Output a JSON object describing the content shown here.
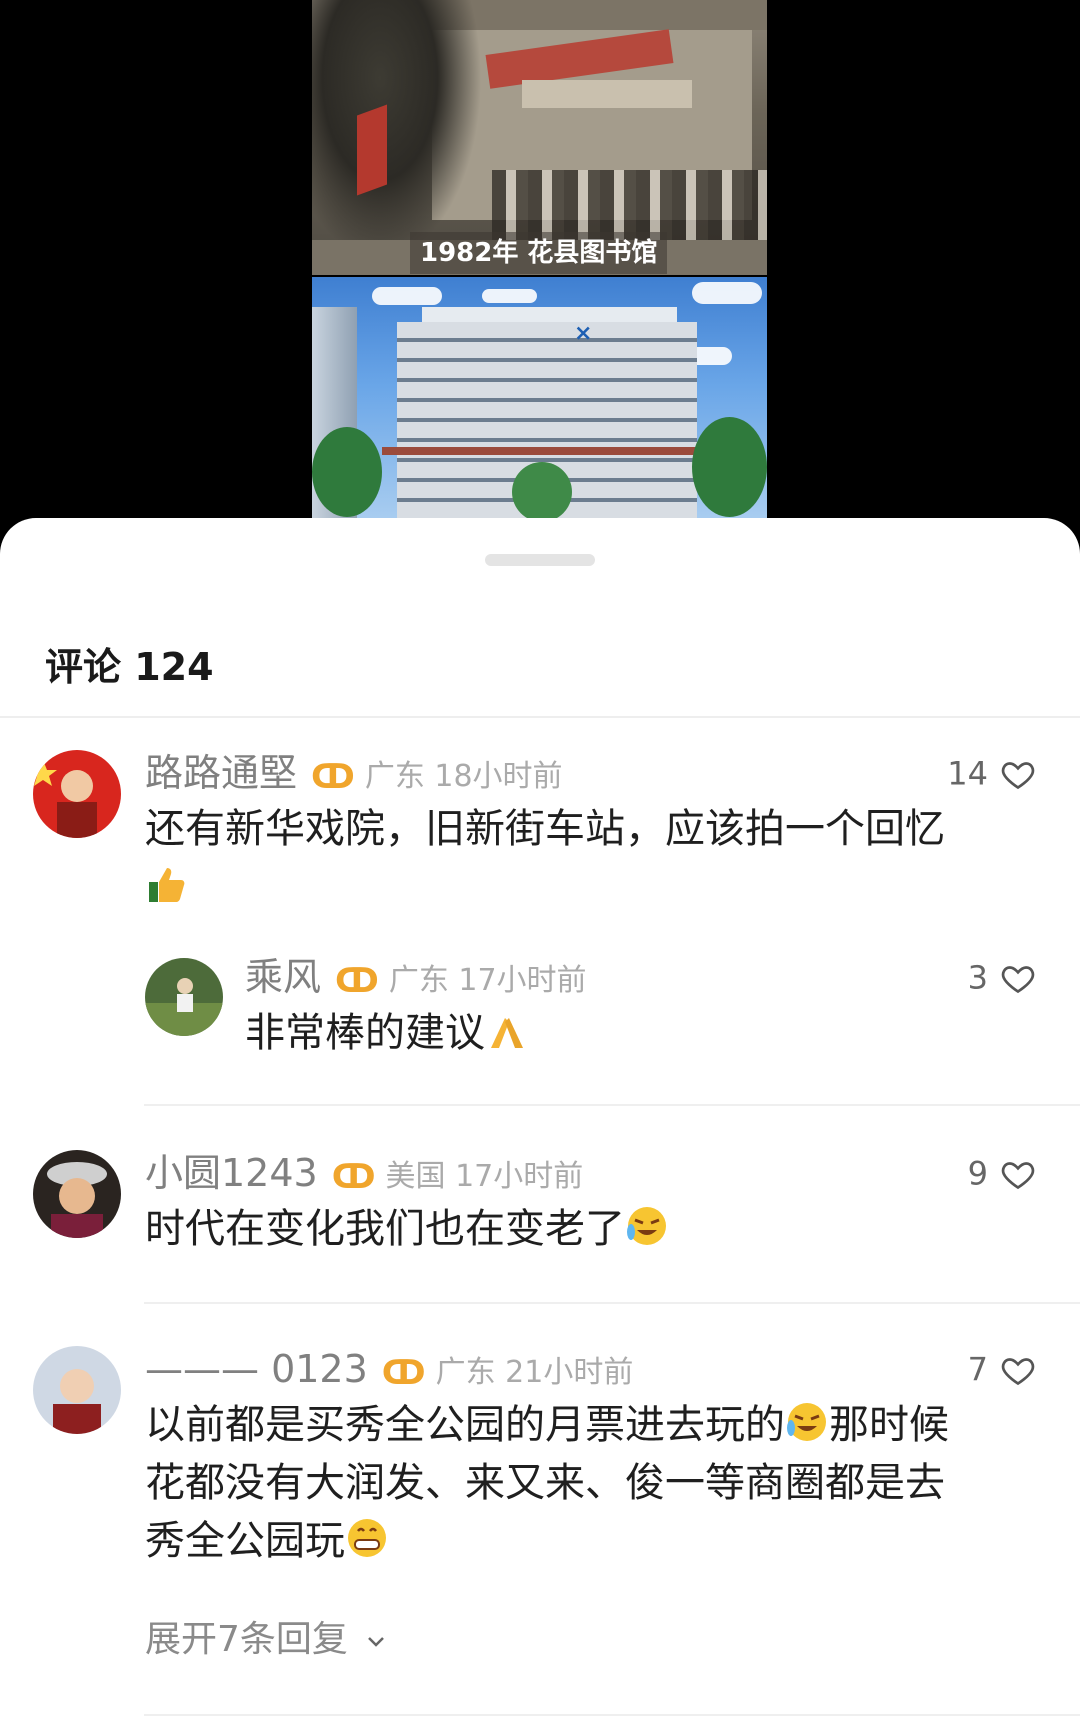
{
  "media": {
    "old_photo_caption": "1982年 花县图书馆"
  },
  "comments_panel": {
    "title": "评论 124"
  },
  "comments": [
    {
      "user": "路路通堅",
      "badge_icon": "ribbon-badge-icon",
      "meta": "广东 18小时前",
      "likes": "14",
      "text": "还有新华戏院，旧新街车站，应该拍一个回忆",
      "emoji": "thumbs-up-emoji"
    },
    {
      "user": "乘风",
      "badge_icon": "ribbon-badge-icon",
      "meta": "广东 17小时前",
      "likes": "3",
      "text": "非常棒的建议",
      "emoji": "praying-hands-emoji"
    },
    {
      "user": "小圆1243",
      "badge_icon": "ribbon-badge-icon",
      "meta": "美国 17小时前",
      "likes": "9",
      "text": "时代在变化我们也在变老了",
      "emoji": "crying-laughing-emoji"
    },
    {
      "user": "——— 0123",
      "badge_icon": "ribbon-badge-icon",
      "meta": "广东 21小时前",
      "likes": "7",
      "text_line1": "以前都是买秀全公园的月票进去玩的",
      "text_line1_tail": "那时候",
      "text_line2": "花都没有大润发、来又来、俊一等商圈都是去",
      "text_line3": "秀全公园玩",
      "emoji1": "crying-laughing-emoji",
      "emoji2": "grinning-emoji"
    }
  ],
  "expand_replies": "展开7条回复",
  "colors": {
    "badge": "#f0a52c",
    "meta": "#aaaaaa",
    "username": "#808080"
  }
}
